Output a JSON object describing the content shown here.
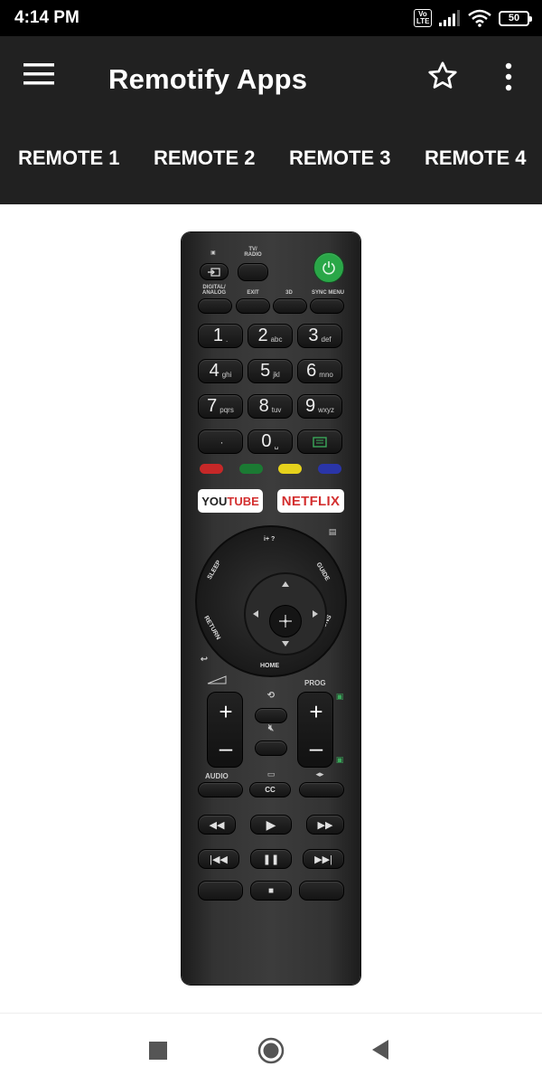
{
  "status": {
    "time": "4:14 PM",
    "volte": "Vo LTE",
    "battery": "50"
  },
  "appbar": {
    "title": "Remotify Apps",
    "menu_icon": "menu-icon",
    "star_icon": "star-icon",
    "more_icon": "more-vert-icon"
  },
  "tabs": [
    "REMOTE 1",
    "REMOTE 2",
    "REMOTE 3",
    "REMOTE 4"
  ],
  "remote": {
    "labels": {
      "tv_radio": "TV/ RADIO",
      "digital_analog": "DIGITAL/ ANALOG",
      "exit": "EXIT",
      "three_d": "3D",
      "sync_menu": "SYNC MENU",
      "info": "i+ ?",
      "sleep": "SLEEP",
      "guide": "GUIDE",
      "return": "RETURN",
      "options": "OPTIONS",
      "home": "HOME",
      "prog": "PROG",
      "audio": "AUDIO",
      "cc": "CC"
    },
    "numbers": [
      {
        "digit": "1",
        "sub": "."
      },
      {
        "digit": "2",
        "sub": "abc"
      },
      {
        "digit": "3",
        "sub": "def"
      },
      {
        "digit": "4",
        "sub": "ghi"
      },
      {
        "digit": "5",
        "sub": "jkl"
      },
      {
        "digit": "6",
        "sub": "mno"
      },
      {
        "digit": "7",
        "sub": "pqrs"
      },
      {
        "digit": "8",
        "sub": "tuv"
      },
      {
        "digit": "9",
        "sub": "wxyz"
      },
      {
        "digit": "",
        "sub": "·"
      },
      {
        "digit": "0",
        "sub": "␣"
      }
    ],
    "youtube": {
      "you": "YOU",
      "tube": "TUBE"
    },
    "netflix": "NETFLIX",
    "colors": {
      "red": "#c62828",
      "green": "#1b7a33",
      "yellow": "#e6d21c",
      "blue": "#2a35a8",
      "power": "#2aa748"
    }
  }
}
